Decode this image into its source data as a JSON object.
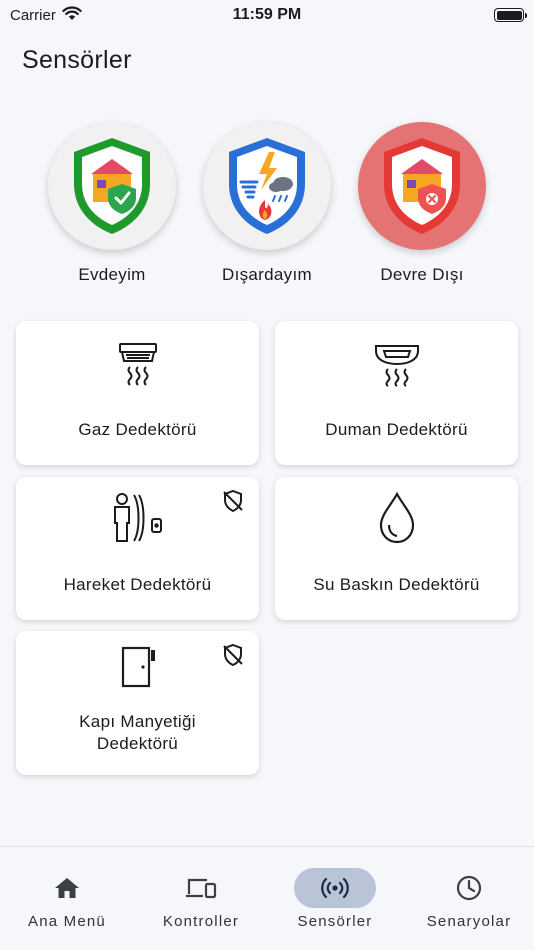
{
  "status_bar": {
    "carrier": "Carrier",
    "time": "11:59 PM"
  },
  "page": {
    "title": "Sensörler"
  },
  "modes": [
    {
      "label": "Evdeyim",
      "icon": "home-shield-check-icon"
    },
    {
      "label": "Dışardayım",
      "icon": "weather-shield-icon"
    },
    {
      "label": "Devre Dışı",
      "icon": "home-shield-disabled-icon",
      "active": true
    }
  ],
  "sensors": [
    {
      "label": "Gaz Dedektörü",
      "icon": "gas-detector-icon"
    },
    {
      "label": "Duman Dedektörü",
      "icon": "smoke-detector-icon"
    },
    {
      "label": "Hareket Dedektörü",
      "icon": "motion-detector-icon",
      "badge": "shield-off-icon"
    },
    {
      "label": "Su Baskın Dedektörü",
      "icon": "water-drop-icon"
    },
    {
      "label": "Kapı Manyetiği\nDedektörü",
      "icon": "door-sensor-icon",
      "badge": "shield-off-icon"
    }
  ],
  "nav": {
    "items": [
      {
        "label": "Ana Menü",
        "icon": "home-icon"
      },
      {
        "label": "Kontroller",
        "icon": "devices-icon"
      },
      {
        "label": "Sensörler",
        "icon": "sensors-icon",
        "active": true
      },
      {
        "label": "Senaryolar",
        "icon": "clock-icon"
      }
    ]
  },
  "colors": {
    "accent_green": "#1e9a2c",
    "accent_blue": "#2a6fd6",
    "accent_red": "#e53935",
    "disabled_mode_bg": "#e57373",
    "active_nav_pill": "#b9c4d6"
  }
}
